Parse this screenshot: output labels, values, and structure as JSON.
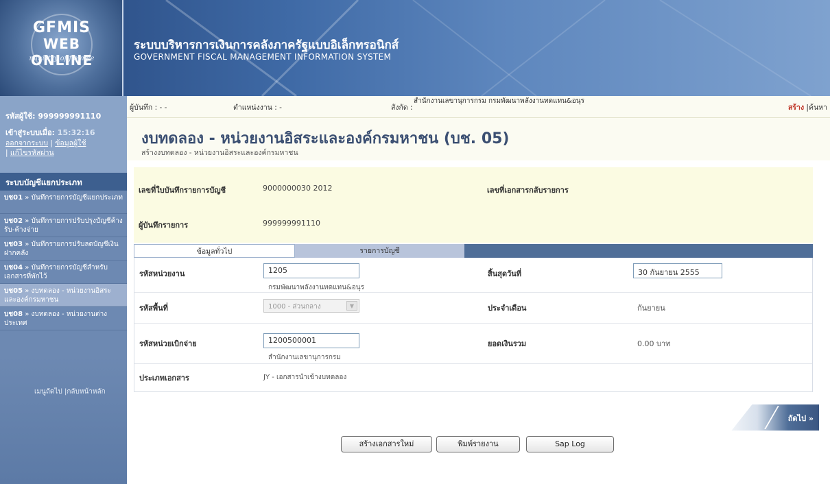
{
  "header": {
    "logo_line1": "GFMIS",
    "logo_line2": "WEB ONLINE",
    "logo_line3": "ministry of finance",
    "title_th": "ระบบบริหารการเงินการคลังภาครัฐแบบอิเล็กทรอนิกส์",
    "title_en": "GOVERNMENT FISCAL MANAGEMENT INFORMATION SYSTEM"
  },
  "sidebar": {
    "user_id": "รหัสผู้ใช้: 999999991110",
    "login_label": "เข้าสู่ระบบเมื่อ: ",
    "login_time": "15:32:16",
    "link_logout": "ออกจากระบบ",
    "link_userinfo": "ข้อมูลผู้ใช้",
    "link_password": "แก้ไขรหัสผ่าน",
    "menu_title": "ระบบบัญชีแยกประเภท",
    "menu": [
      {
        "code": "บช01",
        "label": " » บันทึกรายการบัญชีแยกประเภท"
      },
      {
        "code": "บช02",
        "label": " » บันทึกรายการปรับปรุงบัญชีค้างรับ-ค้างจ่าย"
      },
      {
        "code": "บช03",
        "label": " » บันทึกรายการปรับลดบัญชีเงินฝากคลัง"
      },
      {
        "code": "บช04",
        "label": " » บันทึกรายการบัญชีสำหรับเอกสารที่พักไว้"
      },
      {
        "code": "บช05",
        "label": " » งบทดลอง - หน่วยงานอิสระและองค์กรมหาชน"
      },
      {
        "code": "บช08",
        "label": " » งบทดลอง - หน่วยงานต่างประเทศ"
      }
    ],
    "nav_next": "เมนูถัดไป",
    "nav_home": "กลับหน้าหลัก"
  },
  "topbar": {
    "recorder": "ผู้บันทึก : - -",
    "position": "ตำแหน่งงาน : -",
    "dept_label": "สังกัด :",
    "dept_value": "สำนักงานเลขานุการกรม กรมพัฒนาพลังงานทดแทน&อนุร",
    "create": "สร้าง",
    "search": "ค้นหา"
  },
  "page": {
    "title": "งบทดลอง - หน่วยงานอิสระและองค์กรมหาชน (บช. 05)",
    "subtitle": "สร้างงบทดลอง - หน่วยงานอิสระและองค์กรมหาชน"
  },
  "form_header": {
    "doc_no_label": "เลขที่ใบบันทึกรายการบัญชี",
    "doc_no_value": "9000000030  2012",
    "reverse_label": "เลขที่เอกสารกลับรายการ",
    "recorder_label": "ผู้บันทึกรายการ",
    "recorder_value": "999999991110"
  },
  "tabs": {
    "general": "ข้อมูลทั่วไป",
    "accounts": "รายการบัญชี"
  },
  "form": {
    "agency_label": "รหัสหน่วยงาน",
    "agency_value": "1205",
    "agency_name": "กรมพัฒนาพลังงานทดแทน&อนุร",
    "end_date_label": "สิ้นสุดวันที่",
    "end_date_value": "30 กันยายน 2555",
    "area_label": "รหัสพื้นที่",
    "area_value": "1000 - ส่วนกลาง",
    "month_label": "ประจำเดือน",
    "month_value": "กันยายน",
    "disb_label": "รหัสหน่วยเบิกจ่าย",
    "disb_value": "1200500001",
    "disb_name": "สำนักงานเลขานุการกรม",
    "total_label": "ยอดเงินรวม",
    "total_value": "0.00 บาท",
    "doctype_label": "ประเภทเอกสาร",
    "doctype_value": "JY - เอกสารนำเข้างบทดลอง"
  },
  "buttons": {
    "next": "ถัดไป »",
    "new_doc": "สร้างเอกสารใหม่",
    "print": "พิมพ์รายงาน",
    "saplog": "Sap Log"
  },
  "colors": {
    "header_dark": "#25457a",
    "sidebar": "#6d89b2",
    "tab_bar": "#4f6e98",
    "form_header_bg": "#fbfbe2",
    "title_text": "#3b4f72"
  }
}
